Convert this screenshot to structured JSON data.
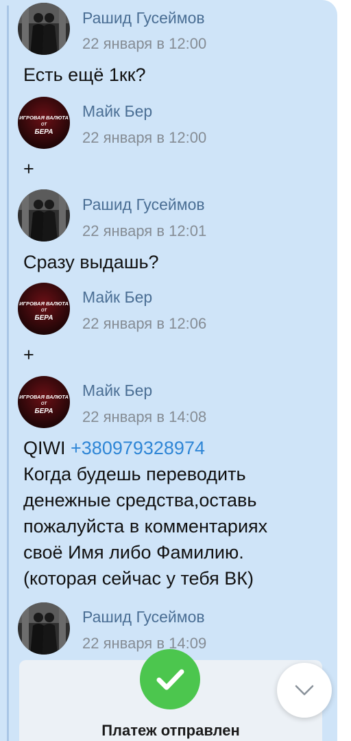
{
  "messages": [
    {
      "type": "message",
      "author": "Рашид Гусеймов",
      "time": "22 января в 12:00",
      "lines": [
        "Есть ещё 1кк?"
      ]
    },
    {
      "type": "message",
      "author": "Майк Бер",
      "time": "22 января в 12:00",
      "lines": [
        "+"
      ]
    },
    {
      "type": "message",
      "author": "Рашид Гусеймов",
      "time": "22 января в 12:01",
      "lines": [
        "Сразу выдашь?"
      ]
    },
    {
      "type": "message",
      "author": "Майк Бер",
      "time": "22 января в 12:06",
      "lines": [
        "+"
      ]
    },
    {
      "type": "message",
      "author": "Майк Бер",
      "time": "22 января в 14:08",
      "qiwi_label": "QIWI",
      "phone": "+380979328974",
      "lines": [
        "Когда будешь переводить",
        "денежные средства,оставь",
        "пожалуйста в комментариях",
        "своё Имя либо Фамилию.",
        "(которая сейчас у тебя ВК)"
      ]
    },
    {
      "type": "message",
      "author": "Рашид Гусеймов",
      "time": "22 января в 14:09",
      "lines": []
    }
  ],
  "avatar_text": {
    "bera": [
      "ИГРОВАЯ ВАЛЮТА",
      "ОТ",
      "БЕРА"
    ]
  },
  "payment_card": {
    "title": "Платеж отправлен",
    "icon": "checkmark-icon",
    "color": "#4cc64e"
  },
  "scroll_button": {
    "icon": "chevron-down-icon"
  },
  "colors": {
    "panel": "#cfe4f8",
    "author": "#4a6e94",
    "time": "#858c94",
    "link": "#2f86d6"
  }
}
